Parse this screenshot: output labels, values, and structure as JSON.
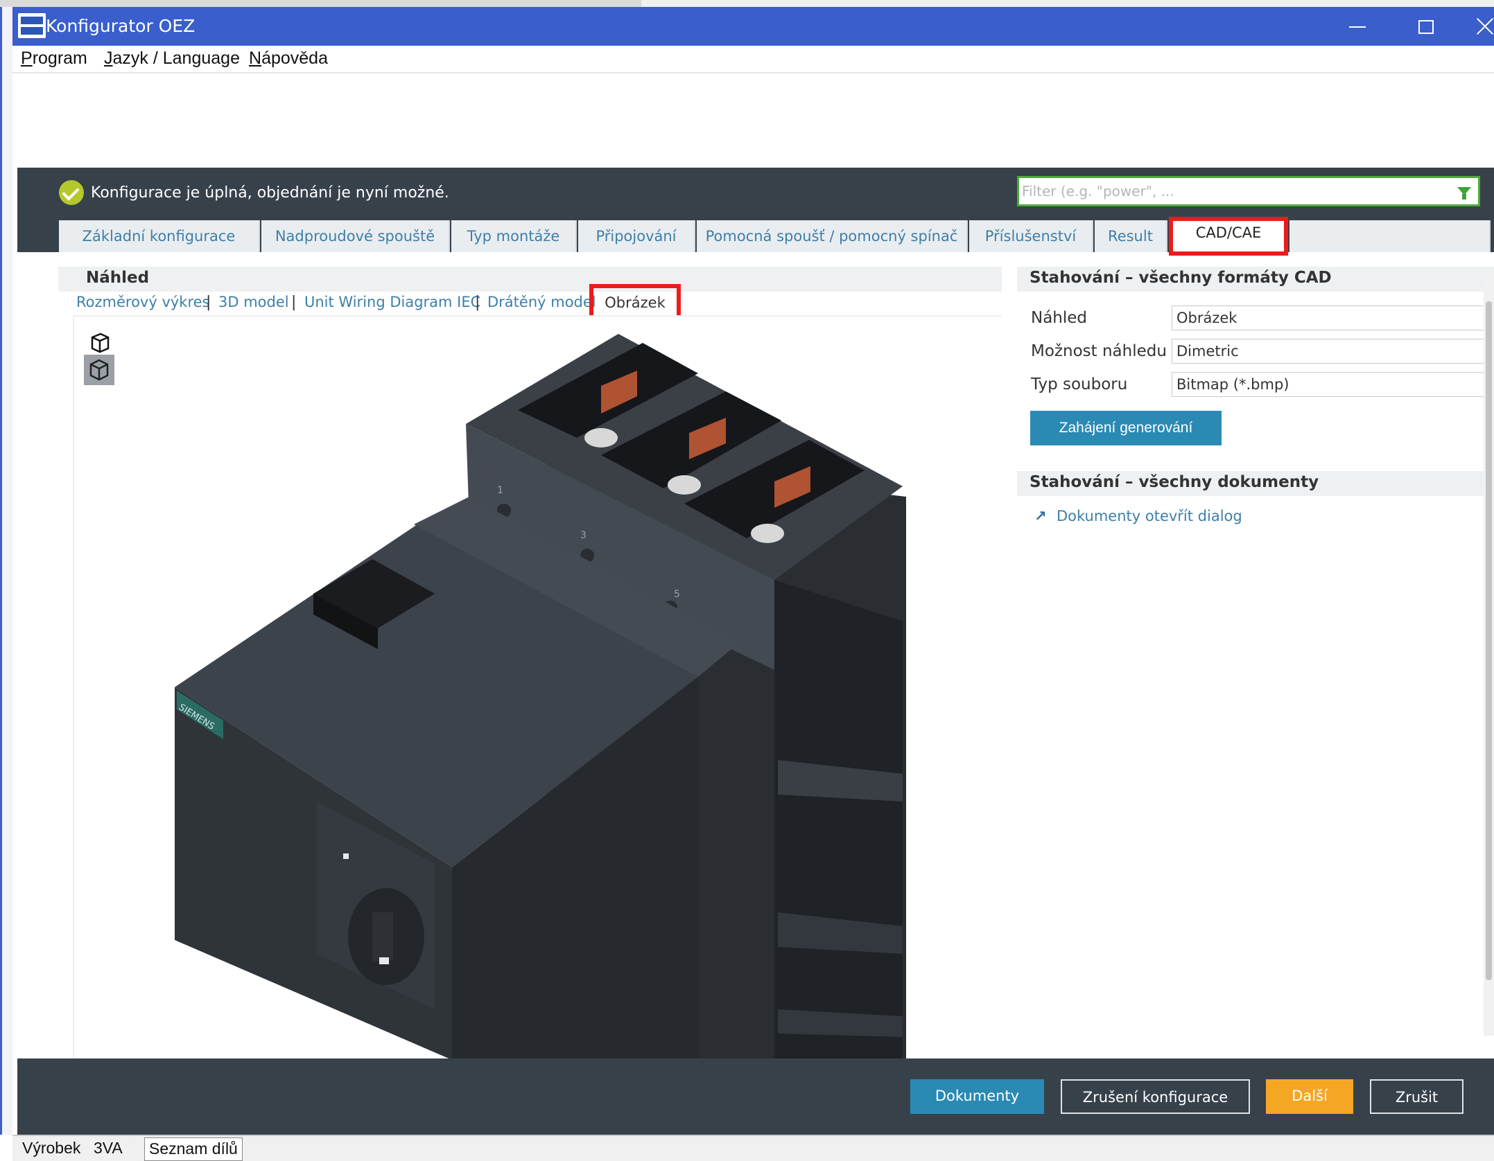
{
  "window": {
    "title": "Konfigurator OEZ",
    "logo_text": "OEZ"
  },
  "menu": {
    "items": [
      {
        "underline": "P",
        "rest": "rogram"
      },
      {
        "underline": "J",
        "rest": "azyk / Language"
      },
      {
        "underline": "N",
        "rest": "ápověda"
      }
    ]
  },
  "status": {
    "message": "Konfigurace je úplná, objednání je nyní možné."
  },
  "filter": {
    "placeholder": "Filter (e.g. \"power\", ..."
  },
  "tabs": [
    "Základní konfigurace",
    "Nadproudové spouště",
    "Typ montáže",
    "Připojování",
    "Pomocná spoušť / pomocný spínač",
    "Příslušenství",
    "Result",
    "CAD/CAE"
  ],
  "active_tab": "CAD/CAE",
  "preview": {
    "title": "Náhled",
    "views": [
      "Rozměrový výkres",
      "3D model",
      "Unit Wiring Diagram IEC",
      "Drátěný model",
      "Obrázek"
    ],
    "active_view": "Obrázek",
    "product_brand": "SIEMENS",
    "terminal_labels": [
      "1",
      "3",
      "5"
    ]
  },
  "cad": {
    "title": "Stahování – všechny formáty CAD",
    "fields": [
      {
        "label": "Náhled",
        "value": "Obrázek"
      },
      {
        "label": "Možnost náhledu",
        "value": "Dimetric"
      },
      {
        "label": "Typ souboru",
        "value": "Bitmap (*.bmp)"
      }
    ],
    "generate_label": "Zahájení generování"
  },
  "docs": {
    "title": "Stahování – všechny dokumenty",
    "link": "Dokumenty otevřít dialog"
  },
  "actions": {
    "dokumenty": "Dokumenty",
    "zruseni": "Zrušení konfigurace",
    "dalsi": "Další",
    "zrusit": "Zrušit"
  },
  "statusbar": {
    "vyrobek": "Výrobek",
    "product": "3VA",
    "seznam": "Seznam dílů"
  },
  "colors": {
    "titlebar": "#3a5fcd",
    "dark_band": "#37414a",
    "accent_blue": "#2a8ab3",
    "accent_orange": "#f5a623",
    "highlight_red": "#ee1b1b",
    "status_ok": "#b5c82b"
  },
  "icons": [
    "app-logo-icon",
    "minimize-icon",
    "maximize-icon",
    "close-icon",
    "check-icon",
    "filter-icon",
    "wireframe-cube-icon",
    "shaded-cube-icon",
    "external-link-arrow-icon"
  ]
}
